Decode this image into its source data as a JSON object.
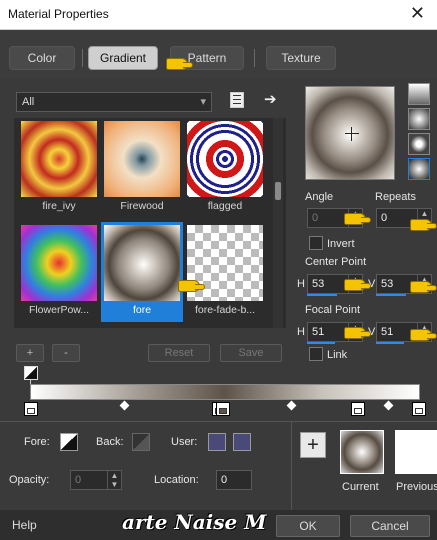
{
  "window": {
    "title": "Material Properties",
    "close": "✕"
  },
  "tabs": [
    {
      "label": "Color"
    },
    {
      "label": "Gradient"
    },
    {
      "label": "Pattern"
    },
    {
      "label": "Texture"
    }
  ],
  "category": {
    "value": "All"
  },
  "gradients": [
    {
      "label": "fire_ivy"
    },
    {
      "label": "Firewood"
    },
    {
      "label": "flagged"
    },
    {
      "label": "FlowerPow..."
    },
    {
      "label": "fore"
    },
    {
      "label": "fore-fade-b..."
    }
  ],
  "list_buttons": {
    "add": "+",
    "remove": "-",
    "reset": "Reset",
    "save": "Save"
  },
  "angle": {
    "label": "Angle",
    "value": "0"
  },
  "repeats": {
    "label": "Repeats",
    "value": "0"
  },
  "invert": {
    "label": "Invert",
    "checked": false
  },
  "center_point": {
    "label": "Center Point",
    "h_label": "H",
    "h": "53",
    "v_label": "V",
    "v": "53"
  },
  "focal_point": {
    "label": "Focal Point",
    "h_label": "H",
    "h": "51",
    "v_label": "V",
    "v": "51"
  },
  "link": {
    "label": "Link",
    "checked": false
  },
  "materials": {
    "fore_label": "Fore:",
    "back_label": "Back:",
    "user_label": "User:",
    "opacity_label": "Opacity:",
    "opacity_value": "0",
    "location_label": "Location:",
    "location_value": "0"
  },
  "history": {
    "add": "+",
    "current": "Current",
    "previous": "Previous"
  },
  "footer": {
    "help": "Help",
    "ok": "OK",
    "cancel": "Cancel"
  },
  "watermark": "arte Naise M",
  "colors": {
    "accent": "#1f7fd9",
    "hand": "#f4c400",
    "user_swatch": "#4a4a78"
  }
}
